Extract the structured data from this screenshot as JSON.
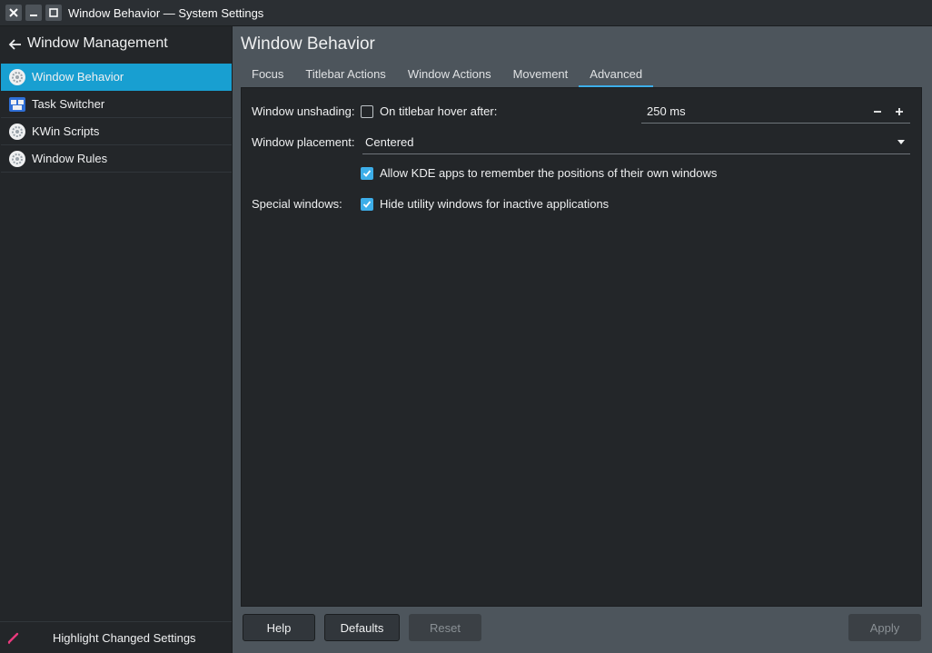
{
  "window": {
    "title": "Window Behavior — System Settings"
  },
  "sidebar": {
    "header": "Window Management",
    "items": [
      {
        "label": "Window Behavior",
        "icon": "gear-icon",
        "active": true
      },
      {
        "label": "Task Switcher",
        "icon": "task-switcher-icon",
        "active": false
      },
      {
        "label": "KWin Scripts",
        "icon": "gear-icon",
        "active": false
      },
      {
        "label": "Window Rules",
        "icon": "gear-icon",
        "active": false
      }
    ],
    "footer_label": "Highlight Changed Settings"
  },
  "main": {
    "title": "Window Behavior",
    "tabs": [
      {
        "label": "Focus",
        "active": false
      },
      {
        "label": "Titlebar Actions",
        "active": false
      },
      {
        "label": "Window Actions",
        "active": false
      },
      {
        "label": "Movement",
        "active": false
      },
      {
        "label": "Advanced",
        "active": true
      }
    ],
    "form": {
      "unshading_label": "Window unshading:",
      "unshading_checkbox_label": "On titlebar hover after:",
      "unshading_checked": false,
      "unshading_value": "250 ms",
      "placement_label": "Window placement:",
      "placement_value": "Centered",
      "remember_checkbox_label": "Allow KDE apps to remember the positions of their own windows",
      "remember_checked": true,
      "special_label": "Special windows:",
      "special_checkbox_label": "Hide utility windows for inactive applications",
      "special_checked": true
    }
  },
  "buttons": {
    "help": "Help",
    "defaults": "Defaults",
    "reset": "Reset",
    "apply": "Apply"
  },
  "colors": {
    "accent": "#3daee9",
    "selection": "#189fd1",
    "background": "#232629"
  }
}
